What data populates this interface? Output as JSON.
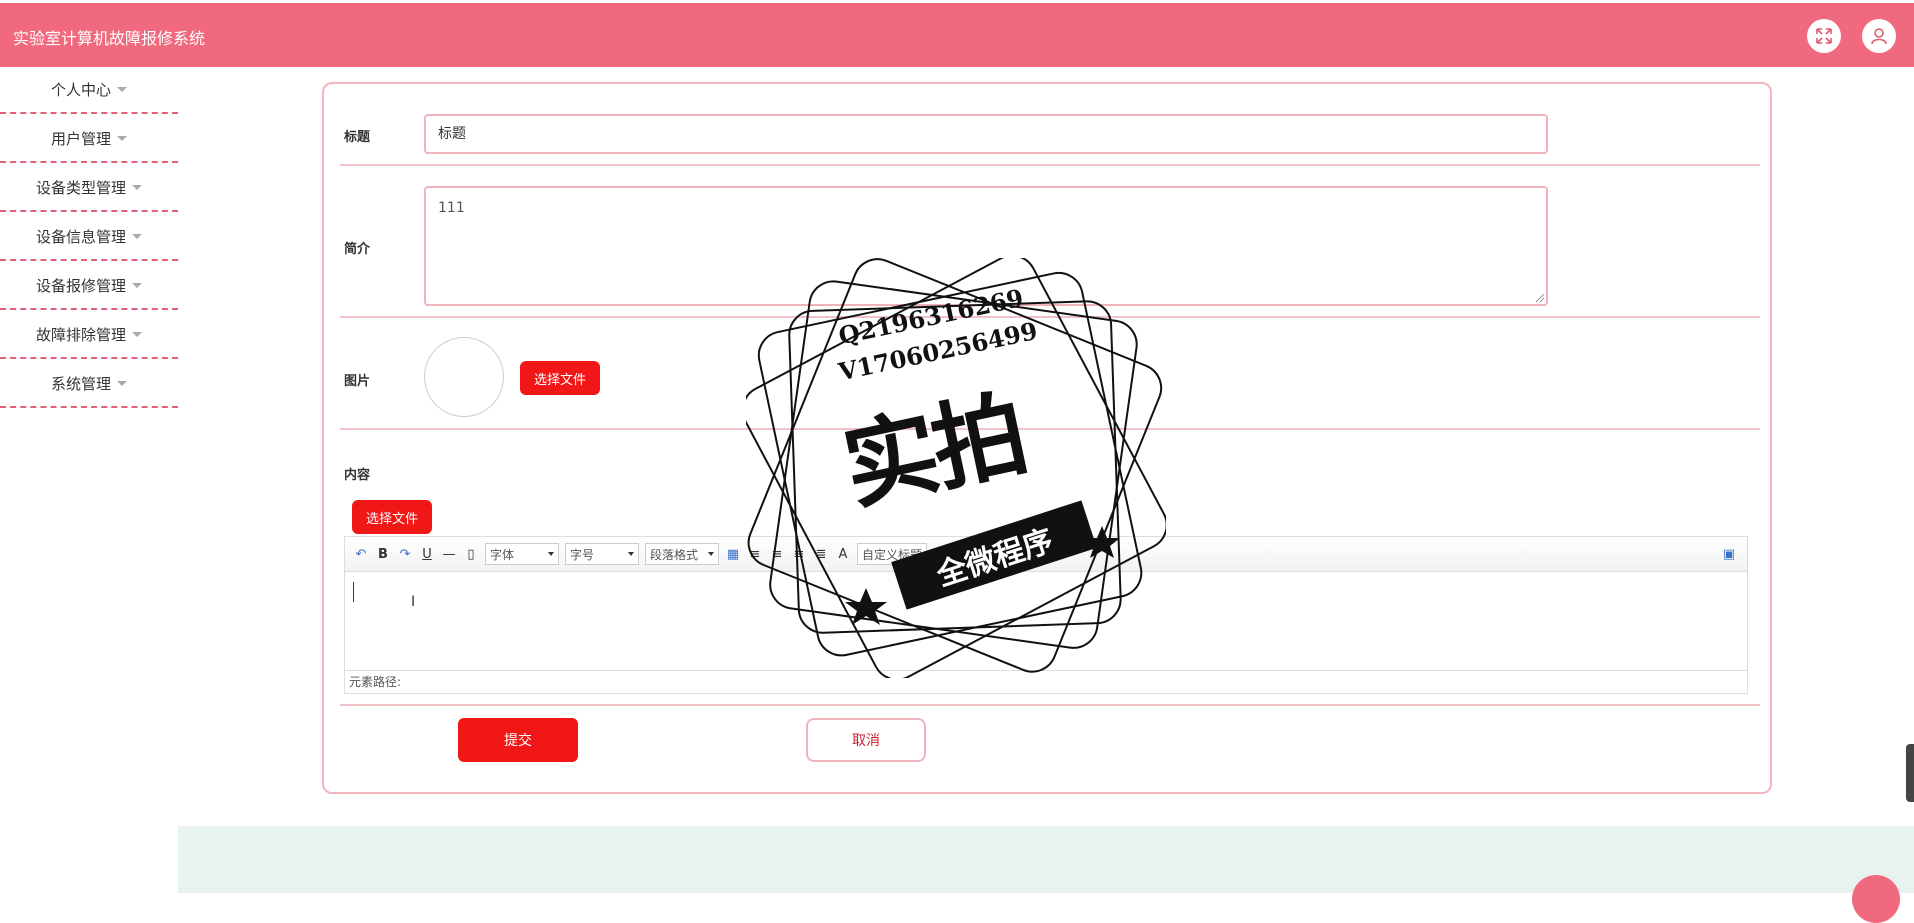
{
  "header": {
    "title": "实验室计算机故障报修系统",
    "icons": [
      "fullscreen-icon",
      "user-icon"
    ]
  },
  "sidebar": {
    "items": [
      {
        "label": "个人中心"
      },
      {
        "label": "用户管理"
      },
      {
        "label": "设备类型管理"
      },
      {
        "label": "设备信息管理"
      },
      {
        "label": "设备报修管理"
      },
      {
        "label": "故障排除管理"
      },
      {
        "label": "系统管理"
      }
    ]
  },
  "form": {
    "title_label": "标题",
    "title_value": "标题",
    "intro_label": "简介",
    "intro_value": "111",
    "image_label": "图片",
    "choose_file_label": "选择文件",
    "content_label": "内容",
    "content_choose_file_label": "选择文件",
    "submit_label": "提交",
    "cancel_label": "取消"
  },
  "editor": {
    "font_select": "字体",
    "size_select": "字号",
    "paragraph_select": "段落格式",
    "custom_title": "自定义标题",
    "path_label": "元素路径:"
  },
  "watermark": {
    "line1": "Q2196316269",
    "line2": "V17060256499",
    "big": "实拍",
    "ribbon": "全微程序"
  },
  "colors": {
    "header": "#f0697e",
    "primary_button": "#f21717",
    "border": "#f0b3bb",
    "footer": "#e8f2ee"
  }
}
